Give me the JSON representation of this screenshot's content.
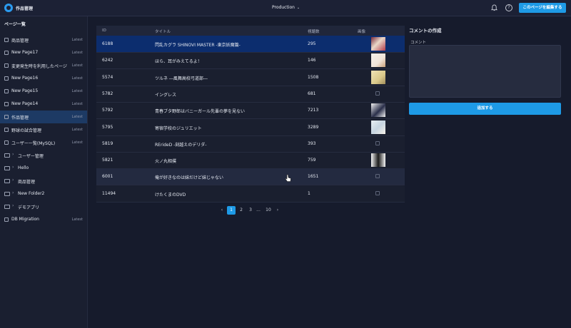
{
  "header": {
    "app_title": "作品管理",
    "environment": "Production",
    "edit_page_label": "このページを編集する"
  },
  "sidebar": {
    "title": "ページ一覧",
    "items": [
      {
        "label": "商品管理",
        "tag": "Latest",
        "type": "page"
      },
      {
        "label": "New Page17",
        "tag": "Latest",
        "type": "page"
      },
      {
        "label": "変更発生時を利用したページ",
        "tag": "Latest",
        "type": "page"
      },
      {
        "label": "New Page16",
        "tag": "Latest",
        "type": "page"
      },
      {
        "label": "New Page15",
        "tag": "Latest",
        "type": "page"
      },
      {
        "label": "New Page14",
        "tag": "Latest",
        "type": "page"
      },
      {
        "label": "作品管理",
        "tag": "Latest",
        "type": "page",
        "active": true
      },
      {
        "label": "野球の試合管理",
        "tag": "Latest",
        "type": "page"
      },
      {
        "label": "ユーザー一覧(MySQL)",
        "tag": "Latest",
        "type": "page"
      },
      {
        "label": "ユーザー管理",
        "tag": "",
        "type": "folder"
      },
      {
        "label": "Hello",
        "tag": "",
        "type": "folder"
      },
      {
        "label": "商品管理",
        "tag": "",
        "type": "folder"
      },
      {
        "label": "New Folder2",
        "tag": "",
        "type": "folder"
      },
      {
        "label": "デモアプリ",
        "tag": "",
        "type": "folder"
      },
      {
        "label": "DB Migration",
        "tag": "Latest",
        "type": "page"
      }
    ]
  },
  "table": {
    "columns": [
      "ID",
      "タイトル",
      "視聴数",
      "画像"
    ],
    "rows": [
      {
        "id": "6188",
        "title": "閃乱カグラ SHINOVI MASTER -東京妖魔篇-",
        "views": "295",
        "image": "thumb-1"
      },
      {
        "id": "6242",
        "title": "ほら、耳がみえてるよ！",
        "views": "146",
        "image": "thumb-2"
      },
      {
        "id": "5574",
        "title": "ツルネ ―風舞高校弓道部―",
        "views": "1508",
        "image": "thumb-3"
      },
      {
        "id": "5782",
        "title": "イングレス",
        "views": "681",
        "image": ""
      },
      {
        "id": "5792",
        "title": "青春ブタ野郎はバニーガール先輩の夢を見ない",
        "views": "7213",
        "image": "thumb-4"
      },
      {
        "id": "5795",
        "title": "寄宿学校のジュリエット",
        "views": "3289",
        "image": "thumb-5"
      },
      {
        "id": "5819",
        "title": "RErideD -刻越えのデリダ-",
        "views": "393",
        "image": ""
      },
      {
        "id": "5821",
        "title": "火ノ丸相撲",
        "views": "759",
        "image": "thumb-6"
      },
      {
        "id": "6001",
        "title": "俺が好きなのは妹だけど妹じゃない",
        "views": "1651",
        "image": ""
      },
      {
        "id": "11494",
        "title": "けたくまのDVD",
        "views": "1",
        "image": ""
      }
    ]
  },
  "pagination": {
    "prev": "‹",
    "pages": [
      "1",
      "2",
      "3"
    ],
    "ellipsis": "...",
    "last": "10",
    "next": "›",
    "current": "1"
  },
  "comment_panel": {
    "title": "コメントの作成",
    "field_label": "コメント",
    "value": "",
    "submit_label": "追加する"
  },
  "colors": {
    "accent": "#1e9ae6",
    "selected_row": "#0c2d6e",
    "background": "#161b2c"
  }
}
